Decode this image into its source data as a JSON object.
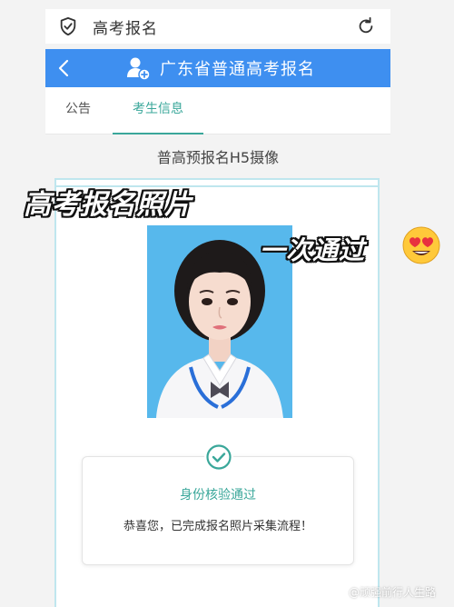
{
  "topbar": {
    "title": "高考报名",
    "shield_icon": "shield-check-icon",
    "refresh_icon": "refresh-icon"
  },
  "header": {
    "title": "广东省普通高考报名",
    "back_icon": "chevron-left-icon",
    "user_icon": "user-plus-icon",
    "color": "#3e8ff0"
  },
  "tabs": [
    {
      "label": "公告",
      "active": false
    },
    {
      "label": "考生信息",
      "active": true
    }
  ],
  "subtitle": "普高预报名H5摄像",
  "overlay": {
    "line1": "高考报名照片",
    "line2": "一次通过",
    "emoji": "heart-eyes-emoji"
  },
  "result": {
    "title": "身份核验通过",
    "message": "恭喜您，已完成报名照片采集流程！",
    "icon": "check-circle-icon"
  },
  "watermark": "@顽强前行人生路",
  "colors": {
    "accent": "#3aa79a",
    "header": "#3e8ff0",
    "photo_bg": "#57b8ec"
  }
}
